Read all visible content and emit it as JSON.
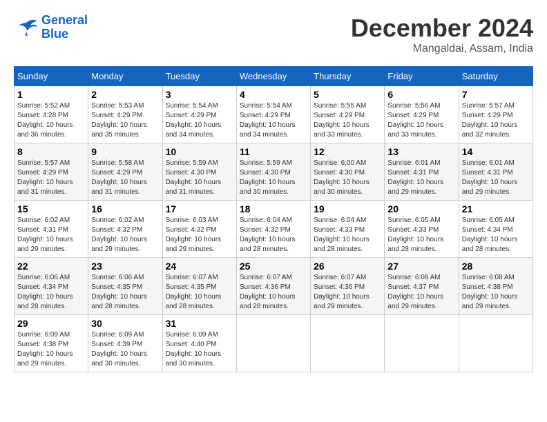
{
  "header": {
    "logo_line1": "General",
    "logo_line2": "Blue",
    "month_title": "December 2024",
    "location": "Mangaldai, Assam, India"
  },
  "weekdays": [
    "Sunday",
    "Monday",
    "Tuesday",
    "Wednesday",
    "Thursday",
    "Friday",
    "Saturday"
  ],
  "weeks": [
    [
      {
        "day": "1",
        "info": "Sunrise: 5:52 AM\nSunset: 4:28 PM\nDaylight: 10 hours\nand 36 minutes."
      },
      {
        "day": "2",
        "info": "Sunrise: 5:53 AM\nSunset: 4:29 PM\nDaylight: 10 hours\nand 35 minutes."
      },
      {
        "day": "3",
        "info": "Sunrise: 5:54 AM\nSunset: 4:29 PM\nDaylight: 10 hours\nand 34 minutes."
      },
      {
        "day": "4",
        "info": "Sunrise: 5:54 AM\nSunset: 4:29 PM\nDaylight: 10 hours\nand 34 minutes."
      },
      {
        "day": "5",
        "info": "Sunrise: 5:55 AM\nSunset: 4:29 PM\nDaylight: 10 hours\nand 33 minutes."
      },
      {
        "day": "6",
        "info": "Sunrise: 5:56 AM\nSunset: 4:29 PM\nDaylight: 10 hours\nand 33 minutes."
      },
      {
        "day": "7",
        "info": "Sunrise: 5:57 AM\nSunset: 4:29 PM\nDaylight: 10 hours\nand 32 minutes."
      }
    ],
    [
      {
        "day": "8",
        "info": "Sunrise: 5:57 AM\nSunset: 4:29 PM\nDaylight: 10 hours\nand 31 minutes."
      },
      {
        "day": "9",
        "info": "Sunrise: 5:58 AM\nSunset: 4:29 PM\nDaylight: 10 hours\nand 31 minutes."
      },
      {
        "day": "10",
        "info": "Sunrise: 5:59 AM\nSunset: 4:30 PM\nDaylight: 10 hours\nand 31 minutes."
      },
      {
        "day": "11",
        "info": "Sunrise: 5:59 AM\nSunset: 4:30 PM\nDaylight: 10 hours\nand 30 minutes."
      },
      {
        "day": "12",
        "info": "Sunrise: 6:00 AM\nSunset: 4:30 PM\nDaylight: 10 hours\nand 30 minutes."
      },
      {
        "day": "13",
        "info": "Sunrise: 6:01 AM\nSunset: 4:31 PM\nDaylight: 10 hours\nand 29 minutes."
      },
      {
        "day": "14",
        "info": "Sunrise: 6:01 AM\nSunset: 4:31 PM\nDaylight: 10 hours\nand 29 minutes."
      }
    ],
    [
      {
        "day": "15",
        "info": "Sunrise: 6:02 AM\nSunset: 4:31 PM\nDaylight: 10 hours\nand 29 minutes."
      },
      {
        "day": "16",
        "info": "Sunrise: 6:02 AM\nSunset: 4:32 PM\nDaylight: 10 hours\nand 29 minutes."
      },
      {
        "day": "17",
        "info": "Sunrise: 6:03 AM\nSunset: 4:32 PM\nDaylight: 10 hours\nand 29 minutes."
      },
      {
        "day": "18",
        "info": "Sunrise: 6:04 AM\nSunset: 4:32 PM\nDaylight: 10 hours\nand 28 minutes."
      },
      {
        "day": "19",
        "info": "Sunrise: 6:04 AM\nSunset: 4:33 PM\nDaylight: 10 hours\nand 28 minutes."
      },
      {
        "day": "20",
        "info": "Sunrise: 6:05 AM\nSunset: 4:33 PM\nDaylight: 10 hours\nand 28 minutes."
      },
      {
        "day": "21",
        "info": "Sunrise: 6:05 AM\nSunset: 4:34 PM\nDaylight: 10 hours\nand 28 minutes."
      }
    ],
    [
      {
        "day": "22",
        "info": "Sunrise: 6:06 AM\nSunset: 4:34 PM\nDaylight: 10 hours\nand 28 minutes."
      },
      {
        "day": "23",
        "info": "Sunrise: 6:06 AM\nSunset: 4:35 PM\nDaylight: 10 hours\nand 28 minutes."
      },
      {
        "day": "24",
        "info": "Sunrise: 6:07 AM\nSunset: 4:35 PM\nDaylight: 10 hours\nand 28 minutes."
      },
      {
        "day": "25",
        "info": "Sunrise: 6:07 AM\nSunset: 4:36 PM\nDaylight: 10 hours\nand 28 minutes."
      },
      {
        "day": "26",
        "info": "Sunrise: 6:07 AM\nSunset: 4:36 PM\nDaylight: 10 hours\nand 29 minutes."
      },
      {
        "day": "27",
        "info": "Sunrise: 6:08 AM\nSunset: 4:37 PM\nDaylight: 10 hours\nand 29 minutes."
      },
      {
        "day": "28",
        "info": "Sunrise: 6:08 AM\nSunset: 4:38 PM\nDaylight: 10 hours\nand 29 minutes."
      }
    ],
    [
      {
        "day": "29",
        "info": "Sunrise: 6:09 AM\nSunset: 4:38 PM\nDaylight: 10 hours\nand 29 minutes."
      },
      {
        "day": "30",
        "info": "Sunrise: 6:09 AM\nSunset: 4:39 PM\nDaylight: 10 hours\nand 30 minutes."
      },
      {
        "day": "31",
        "info": "Sunrise: 6:09 AM\nSunset: 4:40 PM\nDaylight: 10 hours\nand 30 minutes."
      },
      null,
      null,
      null,
      null
    ]
  ]
}
